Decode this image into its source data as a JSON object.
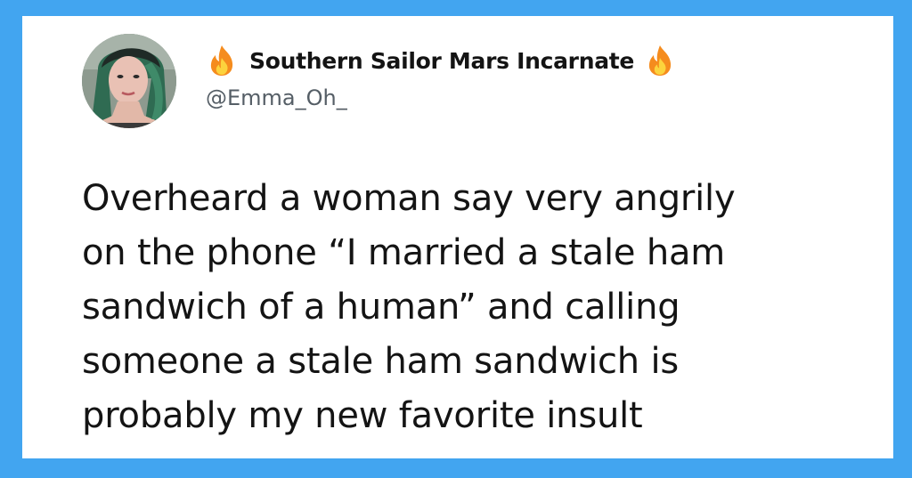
{
  "tweet": {
    "author": {
      "display_name": "Southern Sailor Mars Incarnate",
      "handle": "@Emma_Oh_",
      "name_emoji": "fire-icon"
    },
    "text_lines": [
      "Overheard a woman say very angrily",
      "on the phone “I married a stale ham",
      "sandwich of a human” and calling",
      "someone a stale ham sandwich is",
      "probably my new favorite insult"
    ]
  },
  "colors": {
    "background": "#42a5f0",
    "card": "#ffffff",
    "text": "#141414",
    "handle": "#555e66"
  }
}
